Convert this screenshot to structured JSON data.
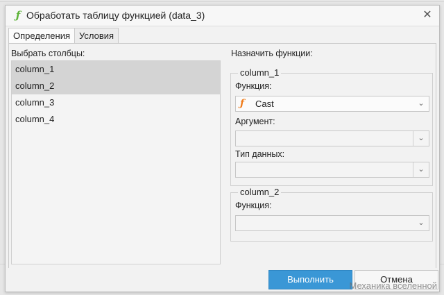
{
  "dialog": {
    "title": "Обработать таблицу функцией (data_3)",
    "icon": "function-icon",
    "close_symbol": "✕"
  },
  "tabs": [
    {
      "label": "Определения",
      "active": true
    },
    {
      "label": "Условия",
      "active": false
    }
  ],
  "left_panel": {
    "label": "Выбрать столбцы:",
    "columns": [
      {
        "label": "column_1",
        "selected": true
      },
      {
        "label": "column_2",
        "selected": true
      },
      {
        "label": "column_3",
        "selected": false
      },
      {
        "label": "column_4",
        "selected": false
      }
    ]
  },
  "right_panel": {
    "label": "Назначить функции:",
    "groups": [
      {
        "title": "column_1",
        "function_label": "Функция:",
        "function_value": "Cast",
        "argument_label": "Аргумент:",
        "argument_value": "",
        "datatype_label": "Тип данных:",
        "datatype_value": ""
      },
      {
        "title": "column_2",
        "function_label": "Функция:",
        "function_value": ""
      }
    ]
  },
  "footer": {
    "run_label": "Выполнить",
    "cancel_label": "Отмена"
  },
  "watermark": "Механика вселенной",
  "colors": {
    "primary_button": "#3a97d6",
    "function_icon_title": "#5db338",
    "function_icon_select": "#f07c1a",
    "selection": "#d4d4d4"
  }
}
